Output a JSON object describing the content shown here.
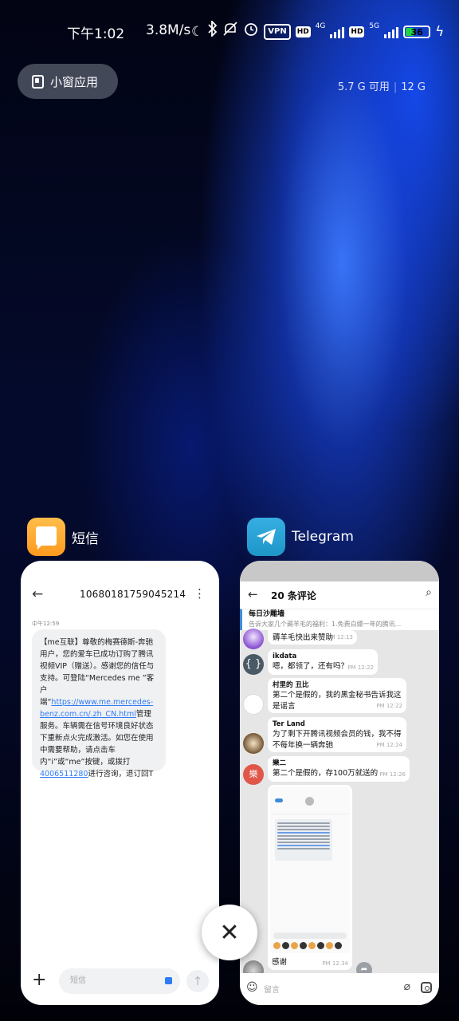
{
  "status_bar": {
    "time": "下午1:02",
    "speed": "3.8M/s",
    "vpn": "VPN",
    "hd": "HD",
    "net1": "4G",
    "net2": "5G",
    "battery": "36",
    "battery_level_percent": 36,
    "icons": [
      "moon-icon",
      "bluetooth-icon",
      "mute-icon",
      "alarm-icon",
      "vpn-icon",
      "hd-icon",
      "signal-4g-icon",
      "signal-5g-icon",
      "battery-icon",
      "charging-icon"
    ]
  },
  "floating_window": {
    "label": "小窗应用"
  },
  "memory": {
    "available": "5.7 G 可用",
    "total": "12 G"
  },
  "apps": [
    {
      "name": "短信",
      "icon": "sms-icon",
      "accent": "#ff9a1f",
      "card": {
        "sender": "10680181759045214",
        "timestamp": "中午12:59",
        "message_part1": "【me互联】尊敬的梅赛德斯-奔驰用户，您的爱车已成功订购了腾讯视频VIP（赠送）。感谢您的信任与支持。可登陆“Mercedes me ”客户端“",
        "message_link": "https://www.me.mercedes-benz.com.cn/.zh_CN.html",
        "message_part2": "管理服务。车辆需在信号环境良好状态下重新点火完成激活。如您在使用中需要帮助，请点击车内“i”或“me”按键，或拨打",
        "message_phone": "4006511280",
        "message_part3": "进行咨询，退订回T",
        "input_placeholder": "短信"
      }
    },
    {
      "name": "Telegram",
      "icon": "telegram-icon",
      "accent": "#2ea6e0",
      "card": {
        "title": "20 条评论",
        "pinned_title": "每日沙雕墙",
        "pinned_text": "告诉大家几个薅羊毛的福利：1.免费白嫖一年的腾讯...",
        "messages": [
          {
            "name": "",
            "text": "薅羊毛快出来赞助",
            "time": "PM 12:13"
          },
          {
            "name": "ikdata",
            "text": "嗯，都领了，还有吗？",
            "time": "PM 12:22"
          },
          {
            "name": "村里的 丑比",
            "text": "第二个是假的，我的黑金秘书告诉我这是谣言",
            "time": "PM 12:22"
          },
          {
            "name": "Ter Land",
            "text": "为了剩下开腾讯视频会员的钱，我不得不每年换一辆奔驰",
            "time": "PM 12:24"
          },
          {
            "name": "樂二",
            "text": "第二个是假的，存100万就送的",
            "time": "PM 12:26",
            "avatar_letter": "樂"
          },
          {
            "name": "",
            "text": "感谢",
            "time": "PM 12:34"
          }
        ],
        "input_placeholder": "留言"
      }
    }
  ],
  "close_label": "✕"
}
